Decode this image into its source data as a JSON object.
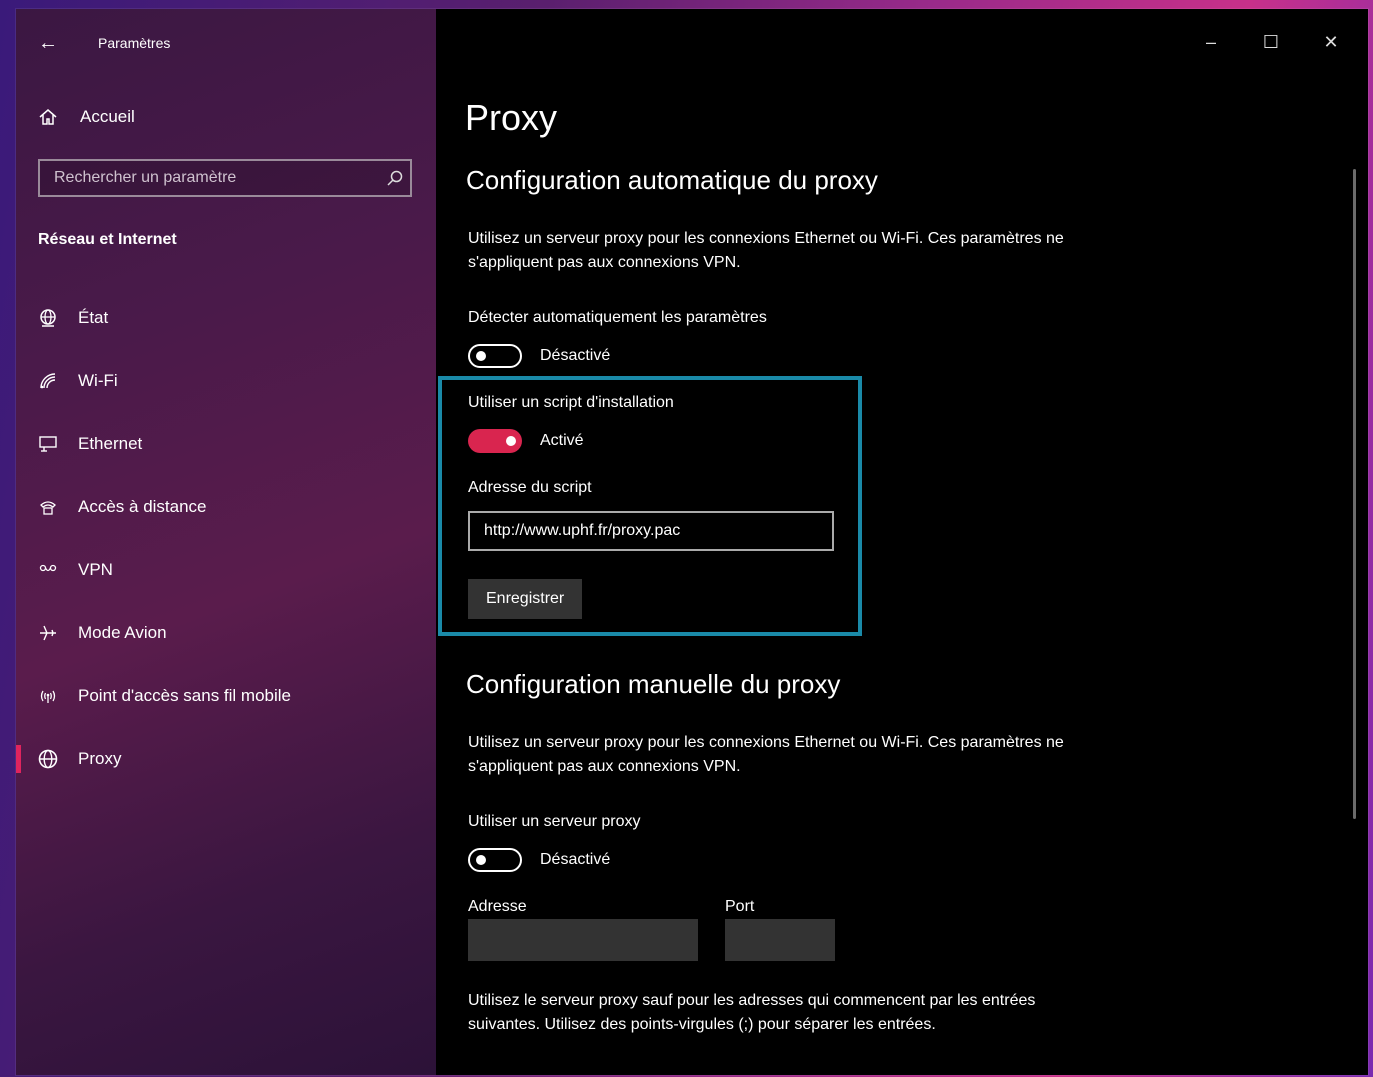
{
  "window": {
    "app_title": "Paramètres",
    "controls": {
      "minimize": "–",
      "maximize": "☐",
      "close": "✕"
    }
  },
  "sidebar": {
    "home_label": "Accueil",
    "search_placeholder": "Rechercher un paramètre",
    "section_title": "Réseau et Internet",
    "items": [
      {
        "label": "État",
        "icon": "globe-status-icon"
      },
      {
        "label": "Wi-Fi",
        "icon": "wifi-icon"
      },
      {
        "label": "Ethernet",
        "icon": "ethernet-icon"
      },
      {
        "label": "Accès à distance",
        "icon": "dialup-icon"
      },
      {
        "label": "VPN",
        "icon": "vpn-icon"
      },
      {
        "label": "Mode Avion",
        "icon": "airplane-icon"
      },
      {
        "label": "Point d'accès sans fil mobile",
        "icon": "hotspot-icon"
      },
      {
        "label": "Proxy",
        "icon": "globe-icon",
        "active": true
      }
    ]
  },
  "main": {
    "title": "Proxy",
    "auto": {
      "heading": "Configuration automatique du proxy",
      "description": "Utilisez un serveur proxy pour les connexions Ethernet ou Wi-Fi. Ces paramètres ne s'appliquent pas aux connexions VPN.",
      "detect_label": "Détecter automatiquement les paramètres",
      "detect_state": "Désactivé",
      "script_label": "Utiliser un script d'installation",
      "script_state": "Activé",
      "address_label": "Adresse du script",
      "address_value": "http://www.uphf.fr/proxy.pac",
      "save_button": "Enregistrer"
    },
    "manual": {
      "heading": "Configuration manuelle du proxy",
      "description": "Utilisez un serveur proxy pour les connexions Ethernet ou Wi-Fi. Ces paramètres ne s'appliquent pas aux connexions VPN.",
      "use_proxy_label": "Utiliser un serveur proxy",
      "use_proxy_state": "Désactivé",
      "address_label": "Adresse",
      "port_label": "Port",
      "exceptions_text": "Utilisez le serveur proxy sauf pour les adresses qui commencent par les entrées suivantes. Utilisez des points-virgules (;) pour séparer les entrées."
    }
  },
  "colors": {
    "accent": "#d9254f",
    "highlight_border": "#1a8aa8"
  }
}
